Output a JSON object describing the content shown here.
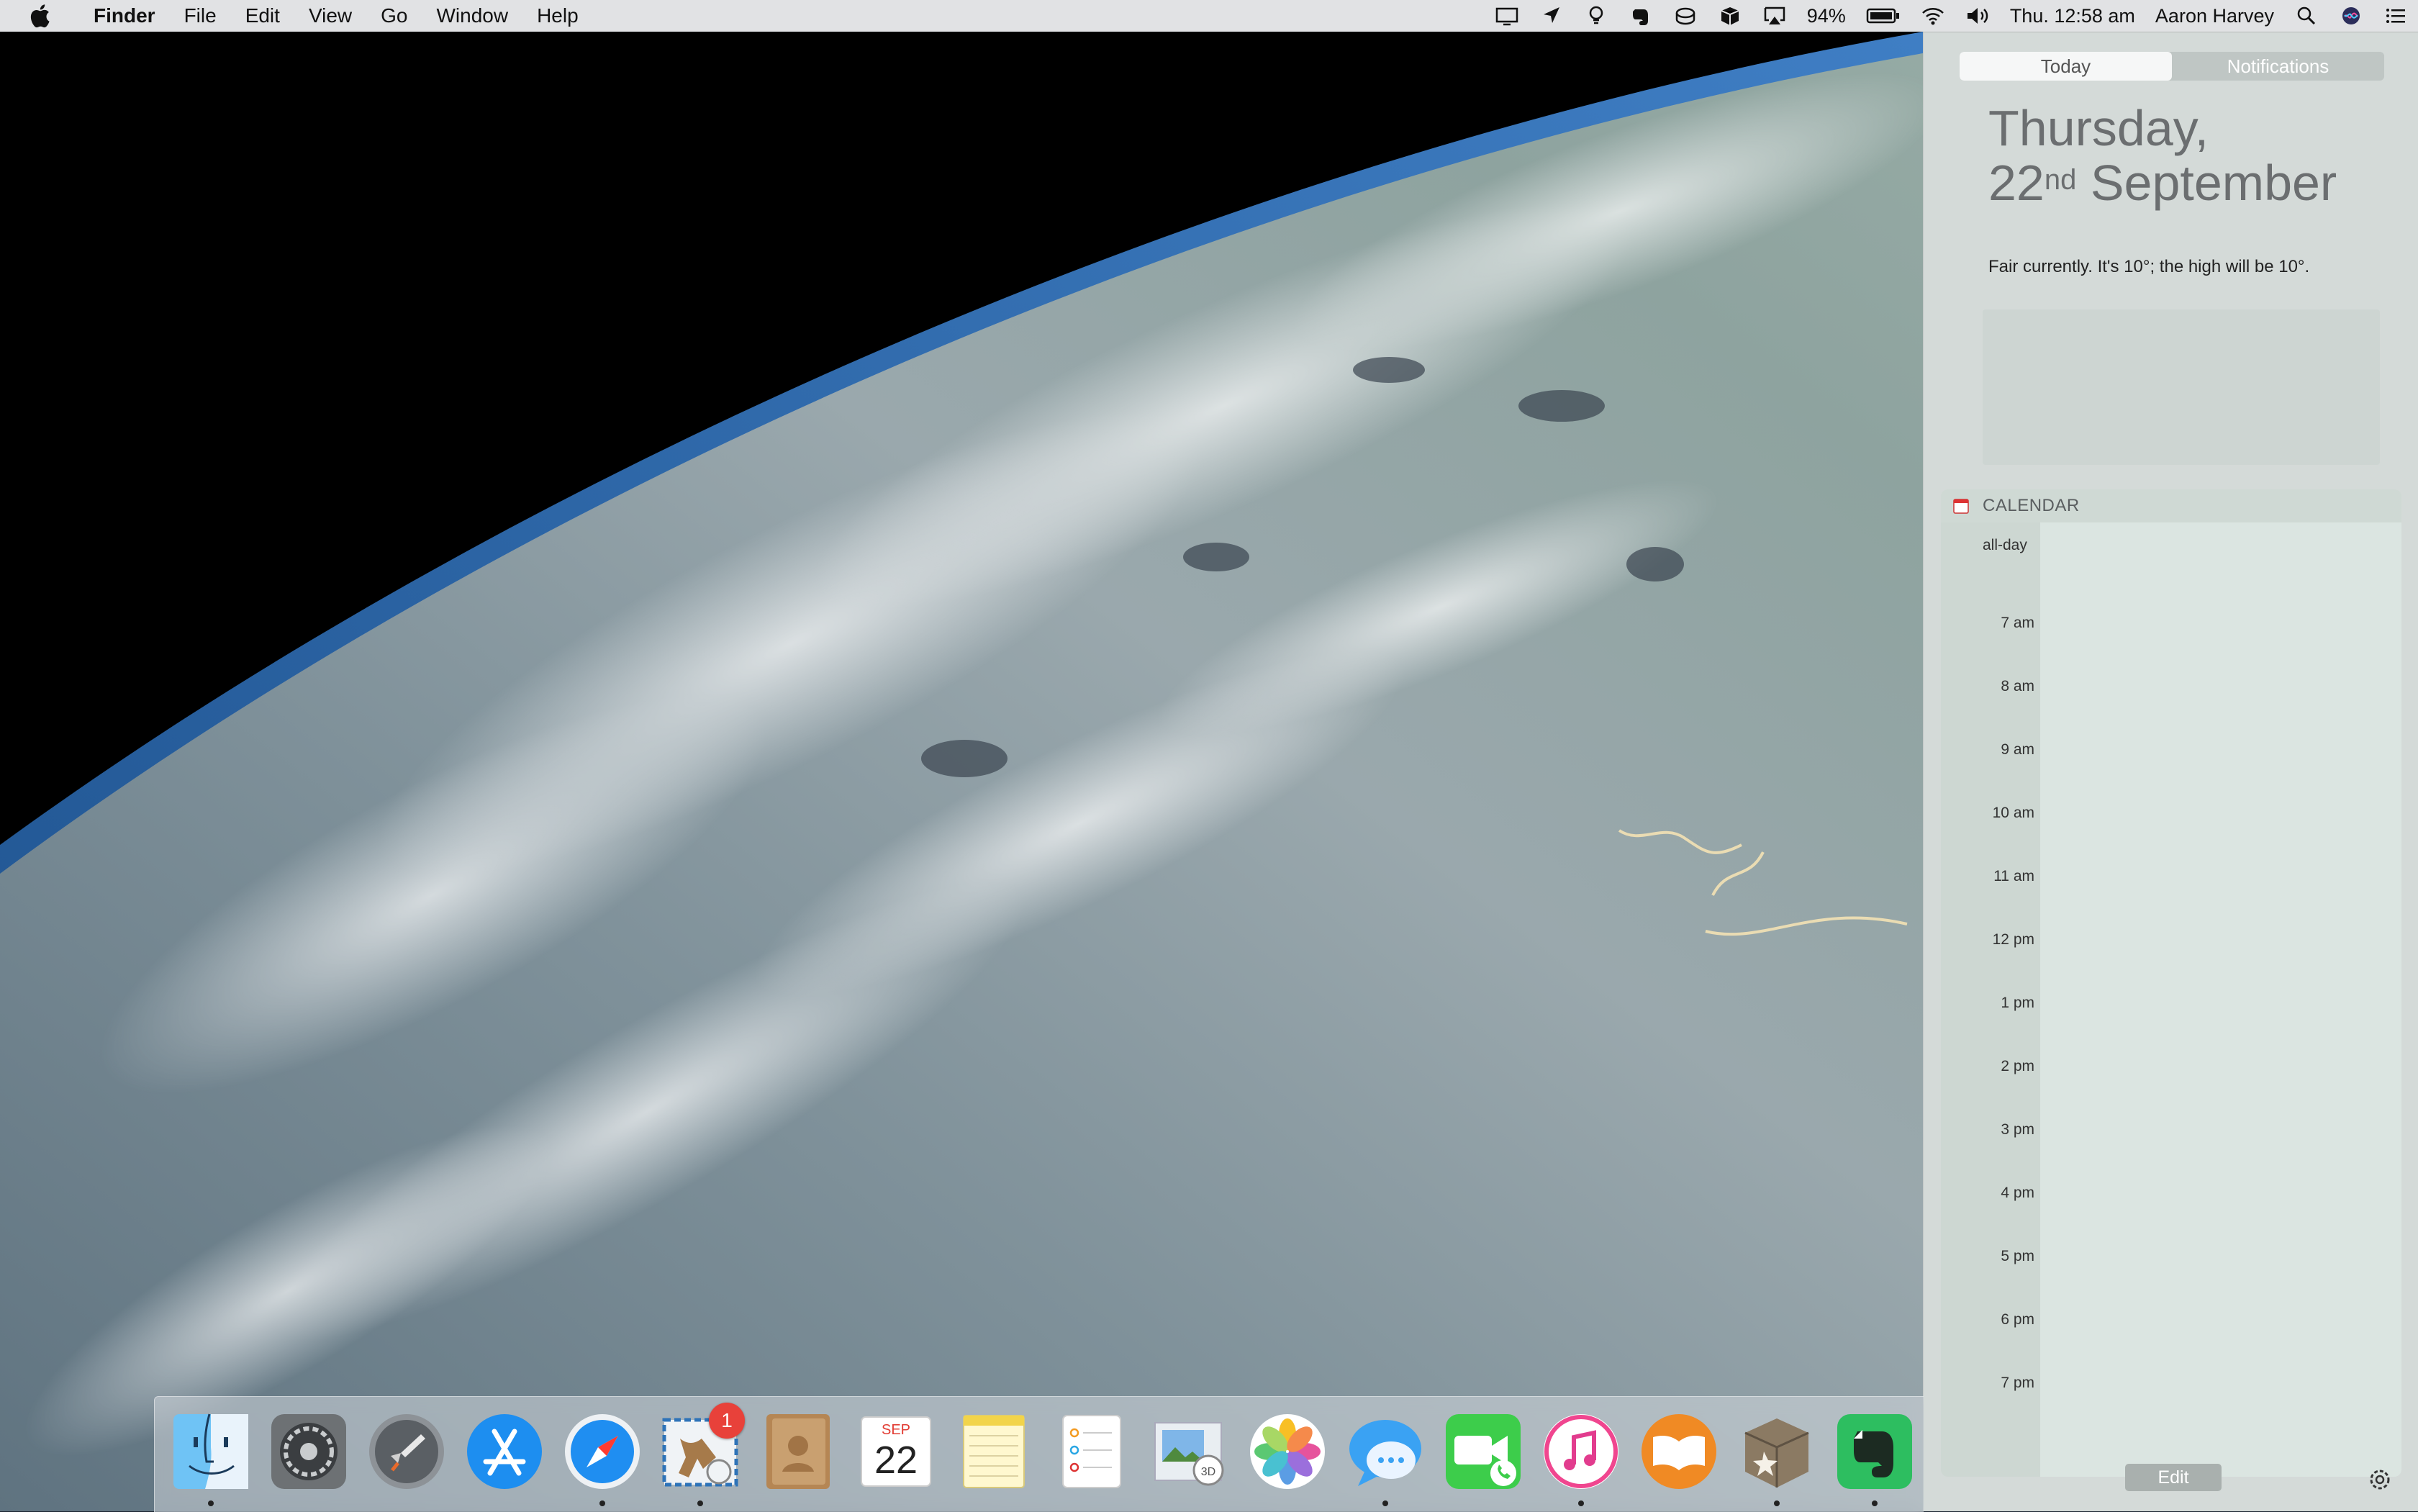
{
  "menubar": {
    "app_name": "Finder",
    "menus": [
      "File",
      "Edit",
      "View",
      "Go",
      "Window",
      "Help"
    ],
    "battery": "94%",
    "clock": "Thu. 12:58 am",
    "user": "Aaron Harvey",
    "status_icons": [
      "airplay-display-icon",
      "location-arrow-icon",
      "bulb-icon",
      "evernote-icon",
      "drive-icon",
      "box-icon",
      "airplay-icon",
      "battery-icon",
      "wifi-icon",
      "volume-icon",
      "search-icon",
      "siri-icon",
      "notification-list-icon"
    ]
  },
  "notification_center": {
    "tabs": [
      "Today",
      "Notifications"
    ],
    "active_tab": "Today",
    "date_line1": "Thursday,",
    "date_day": "22",
    "date_suffix": "nd",
    "date_month": " September",
    "weather_text": "Fair currently. It's 10°; the high will be 10°.",
    "calendar_title": "CALENDAR",
    "all_day_label": "all-day",
    "hours": [
      "7 am",
      "8 am",
      "9 am",
      "10 am",
      "11 am",
      "12 pm",
      "1 pm",
      "2 pm",
      "3 pm",
      "4 pm",
      "5 pm",
      "6 pm",
      "7 pm"
    ],
    "edit_label": "Edit"
  },
  "dock": {
    "apps": [
      {
        "name": "Finder",
        "icon": "finder-icon",
        "running": true
      },
      {
        "name": "System Preferences",
        "icon": "system-preferences-icon",
        "running": false
      },
      {
        "name": "Launchpad",
        "icon": "launchpad-icon",
        "running": false
      },
      {
        "name": "App Store",
        "icon": "app-store-icon",
        "running": false
      },
      {
        "name": "Safari",
        "icon": "safari-icon",
        "running": true
      },
      {
        "name": "Mail",
        "icon": "mail-icon",
        "running": true,
        "badge": "1"
      },
      {
        "name": "Contacts",
        "icon": "contacts-icon",
        "running": false
      },
      {
        "name": "Calendar",
        "icon": "calendar-icon",
        "running": false,
        "month": "SEP",
        "day": "22"
      },
      {
        "name": "Notes",
        "icon": "notes-icon",
        "running": false
      },
      {
        "name": "Reminders",
        "icon": "reminders-icon",
        "running": false
      },
      {
        "name": "Preview",
        "icon": "preview-icon",
        "running": false
      },
      {
        "name": "Photos",
        "icon": "photos-icon",
        "running": false
      },
      {
        "name": "Messages",
        "icon": "messages-icon",
        "running": true
      },
      {
        "name": "FaceTime",
        "icon": "facetime-icon",
        "running": false
      },
      {
        "name": "iTunes",
        "icon": "itunes-icon",
        "running": true
      },
      {
        "name": "iBooks",
        "icon": "ibooks-icon",
        "running": false
      },
      {
        "name": "Archive Utility",
        "icon": "archive-icon",
        "running": true
      },
      {
        "name": "Evernote",
        "icon": "evernote-icon",
        "running": true
      }
    ]
  },
  "colors": {
    "nc_background": "#d4dad8",
    "badge": "#e8413a",
    "menubar": "#e8e8ea"
  }
}
